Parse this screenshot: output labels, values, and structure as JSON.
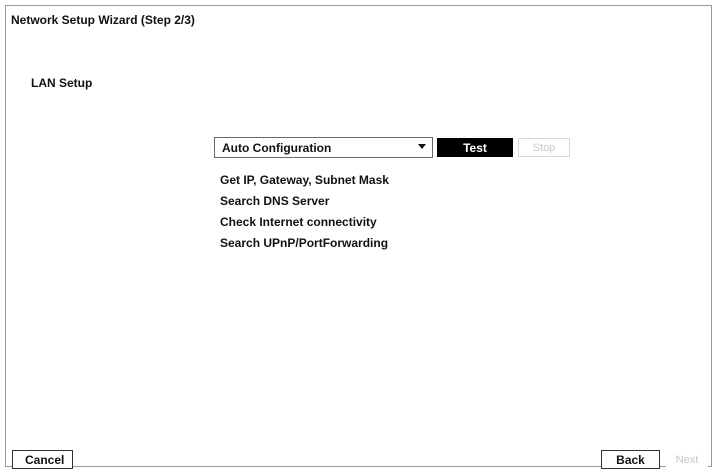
{
  "window": {
    "title": "Network Setup Wizard (Step 2/3)"
  },
  "section": {
    "title": "LAN Setup"
  },
  "config": {
    "selected": "Auto Configuration",
    "test_label": "Test",
    "stop_label": "Stop",
    "stop_enabled": false
  },
  "steps": [
    "Get IP, Gateway, Subnet Mask",
    "Search DNS Server",
    "Check Internet connectivity",
    "Search UPnP/PortForwarding"
  ],
  "footer": {
    "cancel_label": "Cancel",
    "back_label": "Back",
    "next_label": "Next",
    "next_enabled": false
  }
}
